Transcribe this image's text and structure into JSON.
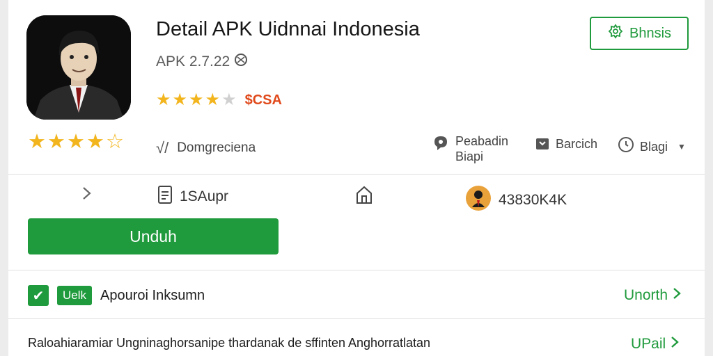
{
  "app": {
    "title": "Detail APK Uidnnai Indonesia",
    "version": "APK 2.7.22",
    "price": "$CSA",
    "top_rating_stars": 4.5,
    "big_rating_stars": 4.5,
    "developer": "Domgreciena"
  },
  "header": {
    "language_button": "Bhnsis"
  },
  "actions": {
    "share_line1": "Peabadin",
    "share_line2": "Biapi",
    "badge": "Barcich",
    "report": "Blagi"
  },
  "stats": {
    "size": "1SAupr",
    "downloads": "43830K4K"
  },
  "download_button": "Unduh",
  "verified_row": {
    "tag": "Uelk",
    "text": "Apouroi Inksumn",
    "link": "Unorth"
  },
  "description_row": {
    "text": "Raloahiaramiar Ungninaghorsanipe thardanak de sffinten Anghorratlatan",
    "link": "UPail"
  },
  "colors": {
    "accent": "#1f9a3c",
    "star": "#f2b51d",
    "price": "#e04a1c"
  }
}
